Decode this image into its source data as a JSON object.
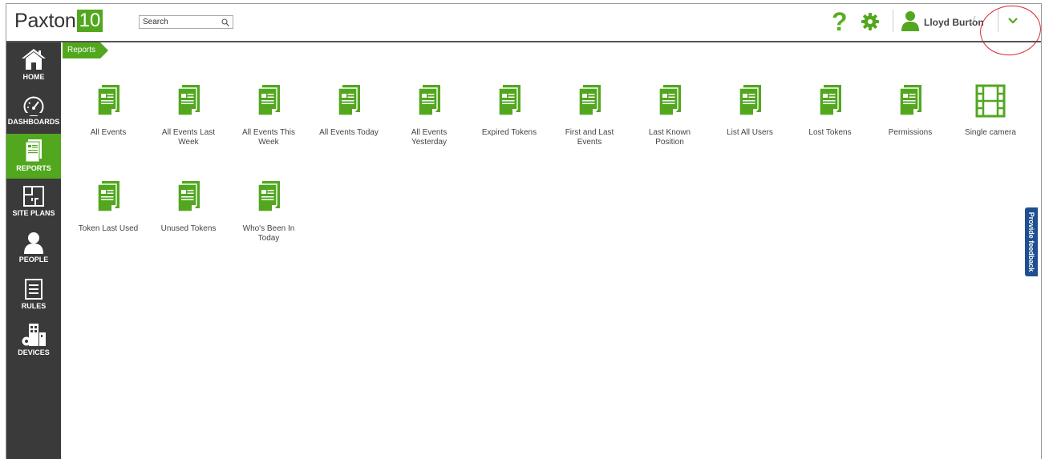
{
  "header": {
    "logo_text": "Paxton",
    "logo_number": "10",
    "search_placeholder": "Search",
    "help_symbol": "?",
    "user_name": "Lloyd Burton",
    "brand_color": "#52a71f"
  },
  "sidebar": {
    "items": [
      {
        "label": "HOME",
        "icon": "home-icon"
      },
      {
        "label": "DASHBOARDS",
        "icon": "dashboard-gauge-icon"
      },
      {
        "label": "REPORTS",
        "icon": "report-icon",
        "active": true
      },
      {
        "label": "SITE PLANS",
        "icon": "site-plan-icon"
      },
      {
        "label": "PEOPLE",
        "icon": "person-icon"
      },
      {
        "label": "RULES",
        "icon": "rules-list-icon"
      },
      {
        "label": "DEVICES",
        "icon": "devices-building-icon"
      }
    ]
  },
  "breadcrumb": {
    "current": "Reports"
  },
  "reports": [
    {
      "label": "All Events",
      "icon": "report-icon"
    },
    {
      "label": "All Events Last Week",
      "icon": "report-icon"
    },
    {
      "label": "All Events This Week",
      "icon": "report-icon"
    },
    {
      "label": "All Events Today",
      "icon": "report-icon"
    },
    {
      "label": "All Events Yesterday",
      "icon": "report-icon"
    },
    {
      "label": "Expired Tokens",
      "icon": "report-icon"
    },
    {
      "label": "First and Last Events",
      "icon": "report-icon"
    },
    {
      "label": "Last Known Position",
      "icon": "report-icon"
    },
    {
      "label": "List All Users",
      "icon": "report-icon"
    },
    {
      "label": "Lost Tokens",
      "icon": "report-icon"
    },
    {
      "label": "Permissions",
      "icon": "report-icon"
    },
    {
      "label": "Single camera",
      "icon": "film-strip-icon"
    },
    {
      "label": "Token Last Used",
      "icon": "report-icon"
    },
    {
      "label": "Unused Tokens",
      "icon": "report-icon"
    },
    {
      "label": "Who's Been In Today",
      "icon": "report-icon"
    }
  ],
  "feedback_tab": {
    "label": "Provide feedback"
  }
}
